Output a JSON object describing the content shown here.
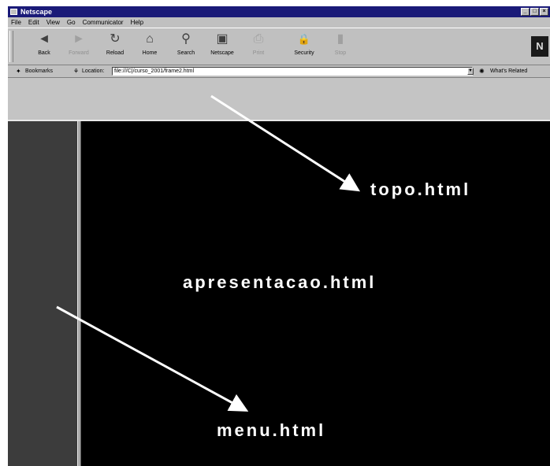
{
  "window": {
    "title": "Netscape",
    "controls": [
      "_",
      "□",
      "×"
    ]
  },
  "menu": [
    "File",
    "Edit",
    "View",
    "Go",
    "Communicator",
    "Help"
  ],
  "toolbar": [
    {
      "label": "Back",
      "icon": "back-icon",
      "glyph": "◄",
      "disabled": false
    },
    {
      "label": "Forward",
      "icon": "forward-icon",
      "glyph": "►",
      "disabled": true
    },
    {
      "label": "Reload",
      "icon": "reload-icon",
      "glyph": "↻",
      "disabled": false
    },
    {
      "label": "Home",
      "icon": "home-icon",
      "glyph": "⌂",
      "disabled": false
    },
    {
      "label": "Search",
      "icon": "search-icon",
      "glyph": "⚲",
      "disabled": false
    },
    {
      "label": "Netscape",
      "icon": "netscape-icon",
      "glyph": "▣",
      "disabled": false
    },
    {
      "label": "Print",
      "icon": "print-icon",
      "glyph": "⎙",
      "disabled": true
    },
    {
      "label": "Security",
      "icon": "lock-icon",
      "glyph": "🔒",
      "disabled": false
    },
    {
      "label": "Stop",
      "icon": "stop-icon",
      "glyph": "▮",
      "disabled": true
    }
  ],
  "logo": "N",
  "location_bar": {
    "bookmarks_label": "Bookmarks",
    "location_label": "Location:",
    "url": "file:///C|/curso_2001/frame2.html",
    "related_label": "What's Related"
  },
  "frames": {
    "top": "topo.html",
    "main": "apresentacao.html",
    "menu": "menu.html"
  },
  "colors": {
    "title_bar": "#1a1a78",
    "chrome": "#c0c0c0",
    "main_frame": "#000000",
    "menu_frame": "#3c3c3c",
    "arrow": "#ffffff"
  }
}
